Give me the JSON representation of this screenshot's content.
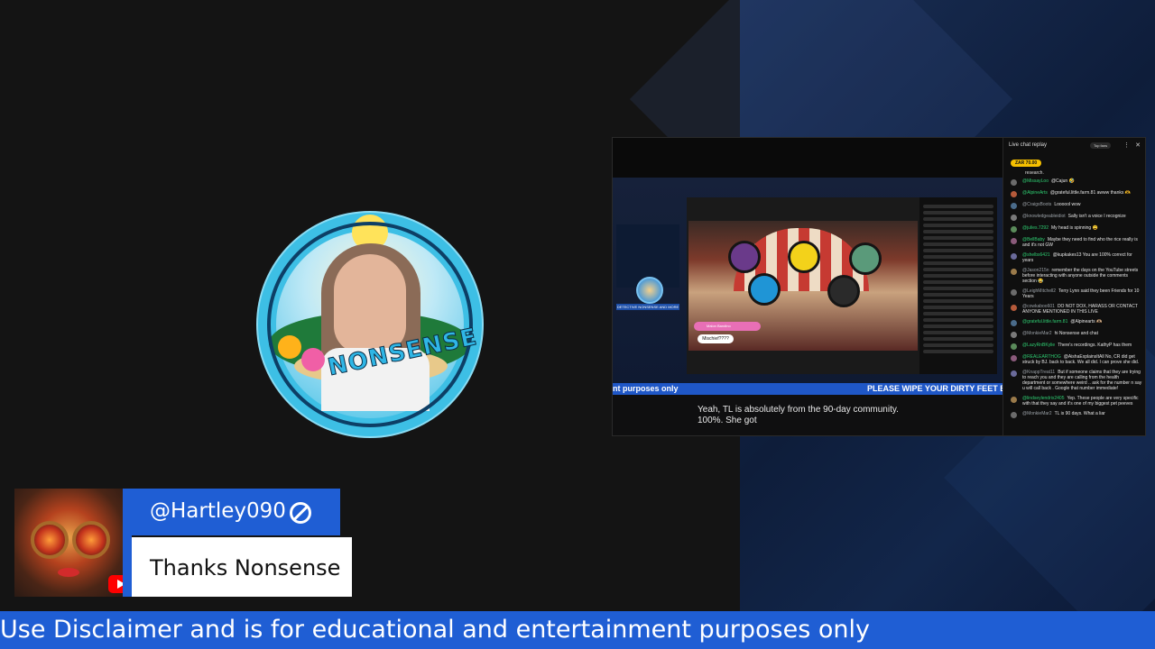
{
  "ticker": {
    "text": "Use Disclaimer and is for educational and entertainment purposes only"
  },
  "commenter": {
    "handle": "@Hartley090",
    "message": "Thanks Nonsense"
  },
  "logo": {
    "wordmark": "NONSENSE"
  },
  "video": {
    "detective_label": "DETECTIVE NONSENSE AND MORE",
    "bubble_name": "Malon Bandino",
    "bubble_text": "Mischief????",
    "ticker_left": "nt purposes only",
    "ticker_right": "PLEASE WIPE YOUR DIRTY FEET BE",
    "caption": "Yeah, TL is absolutely from the 90-day community. 100%. She got"
  },
  "live_chat": {
    "title": "Live chat replay",
    "top_fans": "Top fans",
    "super_chat": "ZAR 70.00",
    "research": "research.",
    "messages": [
      {
        "name": "@MissayLoo",
        "text": "@Cajun 🤣",
        "green": true
      },
      {
        "name": "@AlpineArts",
        "text": "@grateful.little.farm.81 awww thanks 🫶",
        "green": true
      },
      {
        "name": "@CraigsBoots",
        "text": "Loooool wow",
        "green": false
      },
      {
        "name": "@knowledgeableidiot",
        "text": "Sally isn't a voice I recognize",
        "green": false
      },
      {
        "name": "@julies.7292",
        "text": "My head is spinning 😩",
        "green": true
      },
      {
        "name": "@BellBaby",
        "text": "Maybe they need to find who the rice really is and it's not GW",
        "green": true
      },
      {
        "name": "@shelbs6421",
        "text": "@kupkakes13 You are 100% correct for years",
        "green": true
      },
      {
        "name": "@Jason215n",
        "text": "remember the days on the YouTube streets before interacting with anyone outside the comments section 😂",
        "green": false
      },
      {
        "name": "@LeighMitchell2",
        "text": "Terry Lynn said they been Friends for 10 Years",
        "green": false
      },
      {
        "name": "@cowkaboo601",
        "text": "DO NOT DOX, HARASS OR CONTACT ANYONE MENTIONED IN THIS LIVE",
        "green": false
      },
      {
        "name": "@grateful.little.farm.81",
        "text": "@Alpinearts 🫶🏼",
        "green": true
      },
      {
        "name": "@MonkieMar2",
        "text": "hi Nonsense and chat",
        "green": false
      },
      {
        "name": "@LazyRnBKylie",
        "text": "There's recordings. KathyP has them",
        "green": true
      },
      {
        "name": "@REALEARTHOG",
        "text": "@AishaExplainsItAll No, CR did get struck by BJ. back to back. We all did. I can prove she did.",
        "green": true
      },
      {
        "name": "@KnappTreat11",
        "text": "But if someone claims that they are trying to reach you and they are calling from the health department or somewhere weird .. ask for the number n say u will call back . Google that number immediate!",
        "green": false
      },
      {
        "name": "@lindseylendrix2405",
        "text": "Yep. These people are very specific with that they say and it's one of my biggest pet peeves",
        "green": true
      },
      {
        "name": "@MonkieMar2",
        "text": "TL is 90 days. What a liar",
        "green": false
      }
    ]
  },
  "colors": {
    "accent_blue": "#1f5ed4",
    "chat_green": "#2ecc71",
    "super_chat_gold": "#f6c000"
  }
}
